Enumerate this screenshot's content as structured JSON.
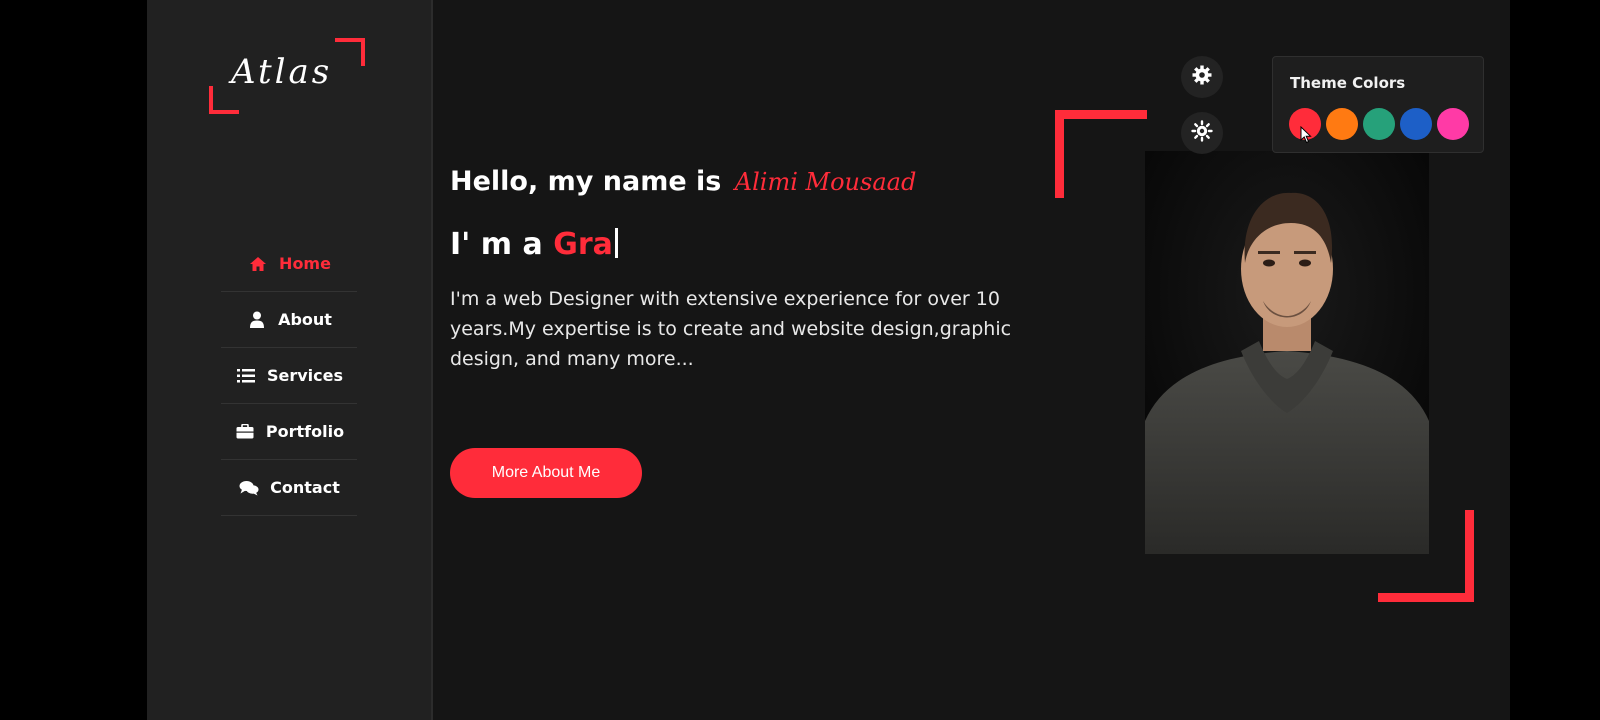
{
  "sidebar": {
    "logo": "Atlas",
    "nav": [
      {
        "label": "Home",
        "icon": "home-icon",
        "active": true
      },
      {
        "label": "About",
        "icon": "user-icon",
        "active": false
      },
      {
        "label": "Services",
        "icon": "list-icon",
        "active": false
      },
      {
        "label": "Portfolio",
        "icon": "briefcase-icon",
        "active": false
      },
      {
        "label": "Contact",
        "icon": "chat-icon",
        "active": false
      }
    ]
  },
  "hero": {
    "greeting": "Hello, my name is",
    "name": "Alimi Mousaad",
    "role_prefix": "I' m a",
    "role_typed": "Gra",
    "description": "I'm a web Designer with extensive experience for over 10 years.My expertise is to create and website design,graphic design, and many more...",
    "cta_label": "More About Me"
  },
  "theme_panel": {
    "title": "Theme Colors",
    "colors": [
      "#ff2c3a",
      "#ff7a12",
      "#26a17a",
      "#1d5fc7",
      "#ff3aa6"
    ]
  },
  "colors": {
    "accent": "#ff2c3a",
    "background": "#151515",
    "sidebar": "#212121"
  }
}
